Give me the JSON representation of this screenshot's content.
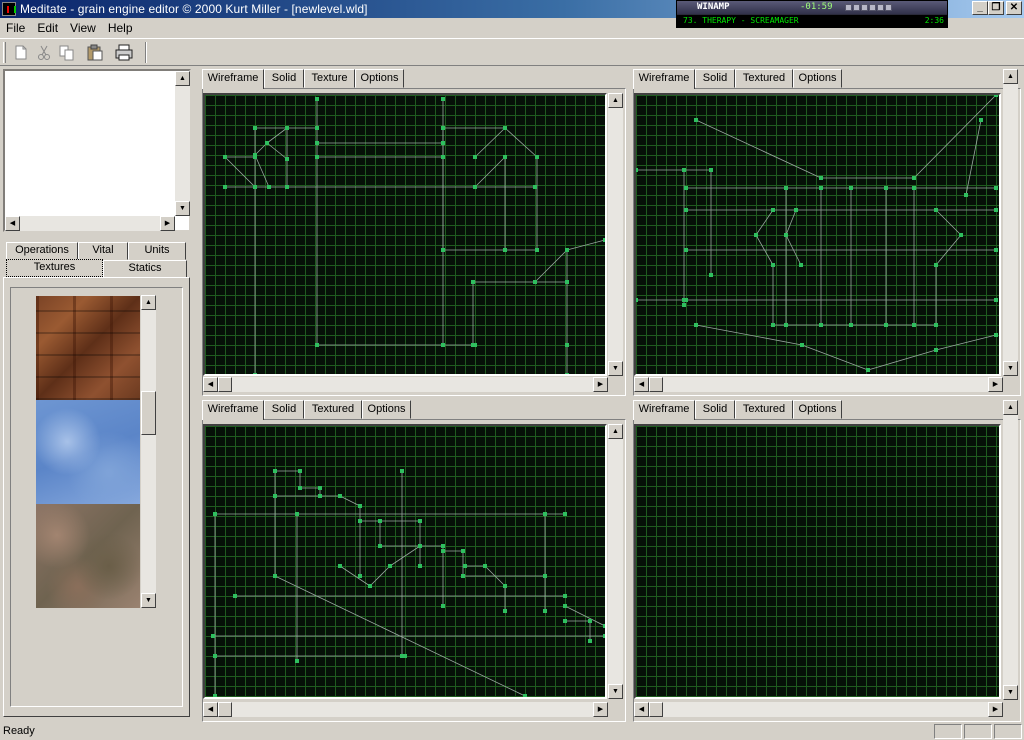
{
  "window": {
    "title": "Meditate - grain engine editor © 2000 Kurt Miller - [newlevel.wld]",
    "minimize": "_",
    "restore": "❐",
    "close": "✕"
  },
  "winamp": {
    "logo": "WINAMP",
    "time": "-01:59",
    "track": "73. THERAPY - SCREAMAGER",
    "length": "2:36"
  },
  "menu": {
    "file": "File",
    "edit": "Edit",
    "view": "View",
    "help": "Help"
  },
  "toolbar": {
    "icons": [
      "new-icon",
      "cut-icon",
      "copy-icon",
      "paste-icon",
      "print-icon"
    ]
  },
  "left_panel": {
    "tabs_row1": [
      "Operations",
      "Vital",
      "Units"
    ],
    "tabs_row2": [
      "Textures",
      "Statics"
    ],
    "active_tab": "Textures",
    "textures": [
      "wood",
      "sky",
      "rock"
    ]
  },
  "viewports": [
    {
      "tabs": [
        "Wireframe",
        "Solid",
        "Texture",
        "Options"
      ],
      "active": "Wireframe"
    },
    {
      "tabs": [
        "Wireframe",
        "Solid",
        "Textured",
        "Options"
      ],
      "active": "Wireframe"
    },
    {
      "tabs": [
        "Wireframe",
        "Solid",
        "Textured",
        "Options"
      ],
      "active": "Wireframe"
    },
    {
      "tabs": [
        "Wireframe",
        "Solid",
        "Textured",
        "Options"
      ],
      "active": "Wireframe"
    }
  ],
  "colors": {
    "grid": "#1f5b1f",
    "canvas_bg": "#061008",
    "vertex": "#2fbf5f",
    "edge": "#9aa8a0"
  },
  "status": {
    "text": "Ready"
  }
}
